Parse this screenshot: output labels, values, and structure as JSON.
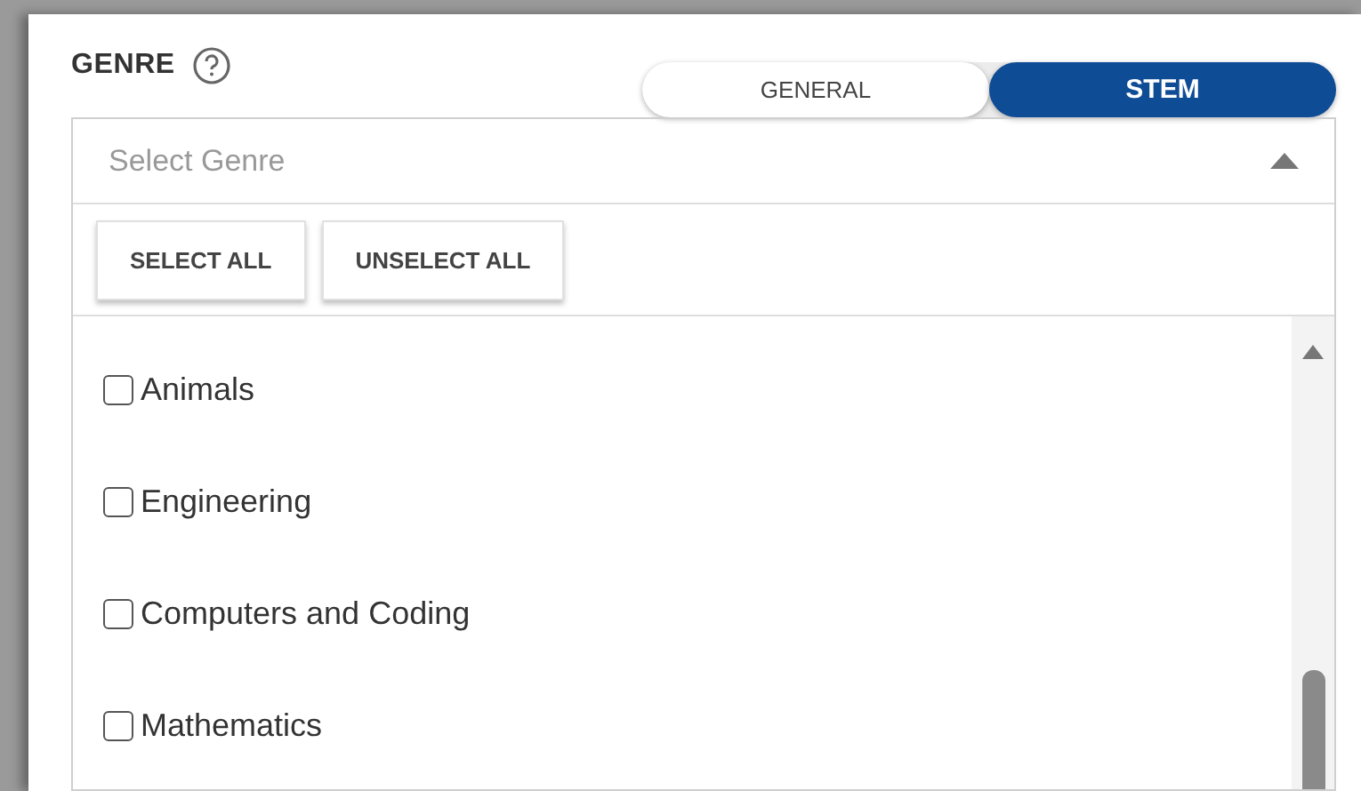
{
  "genre": {
    "label": "GENRE"
  },
  "toggle": [
    {
      "label": "GENERAL",
      "selected": false
    },
    {
      "label": "STEM",
      "selected": true
    }
  ],
  "select": {
    "placeholder": "Select Genre",
    "expanded": true
  },
  "buttons": [
    "SELECT ALL",
    "UNSELECT ALL"
  ],
  "options": [
    {
      "label": "Animals",
      "checked": false
    },
    {
      "label": "Engineering",
      "checked": false
    },
    {
      "label": "Computers and Coding",
      "checked": false
    },
    {
      "label": "Mathematics",
      "checked": false
    }
  ]
}
